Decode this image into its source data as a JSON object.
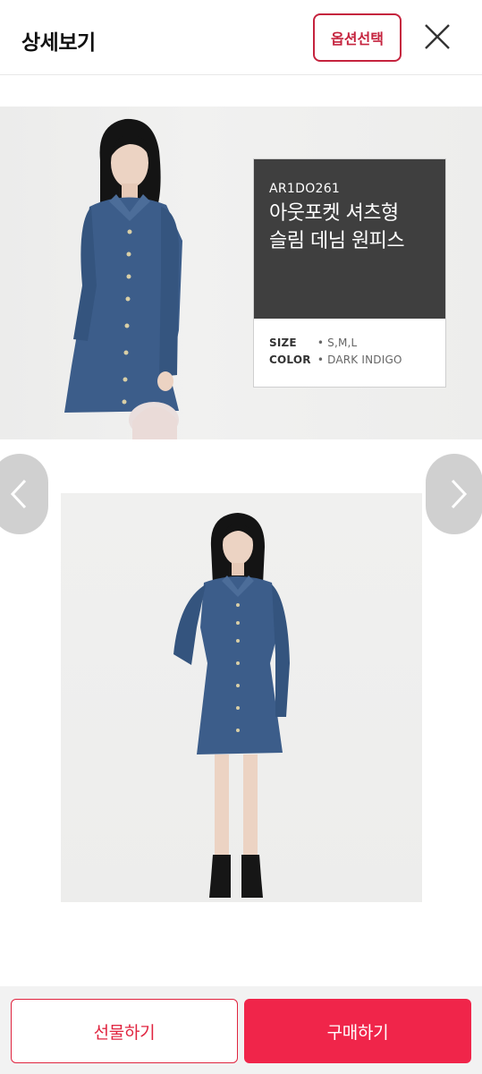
{
  "header": {
    "title": "상세보기",
    "option_button": "옵션선택",
    "close_icon": "close-icon"
  },
  "product": {
    "code": "AR1DO261",
    "name_line1": "아웃포켓 셔츠형",
    "name_line2": "슬림 데님 원피스",
    "size_label": "SIZE",
    "size_value": "• S,M,L",
    "color_label": "COLOR",
    "color_value": "• DARK INDIGO"
  },
  "nav": {
    "prev_icon": "chevron-left-icon",
    "next_icon": "chevron-right-icon"
  },
  "footer": {
    "gift_label": "선물하기",
    "buy_label": "구매하기"
  },
  "colors": {
    "accent": "#f0254a",
    "option_border": "#c5233e",
    "denim": "#3a5a86"
  }
}
